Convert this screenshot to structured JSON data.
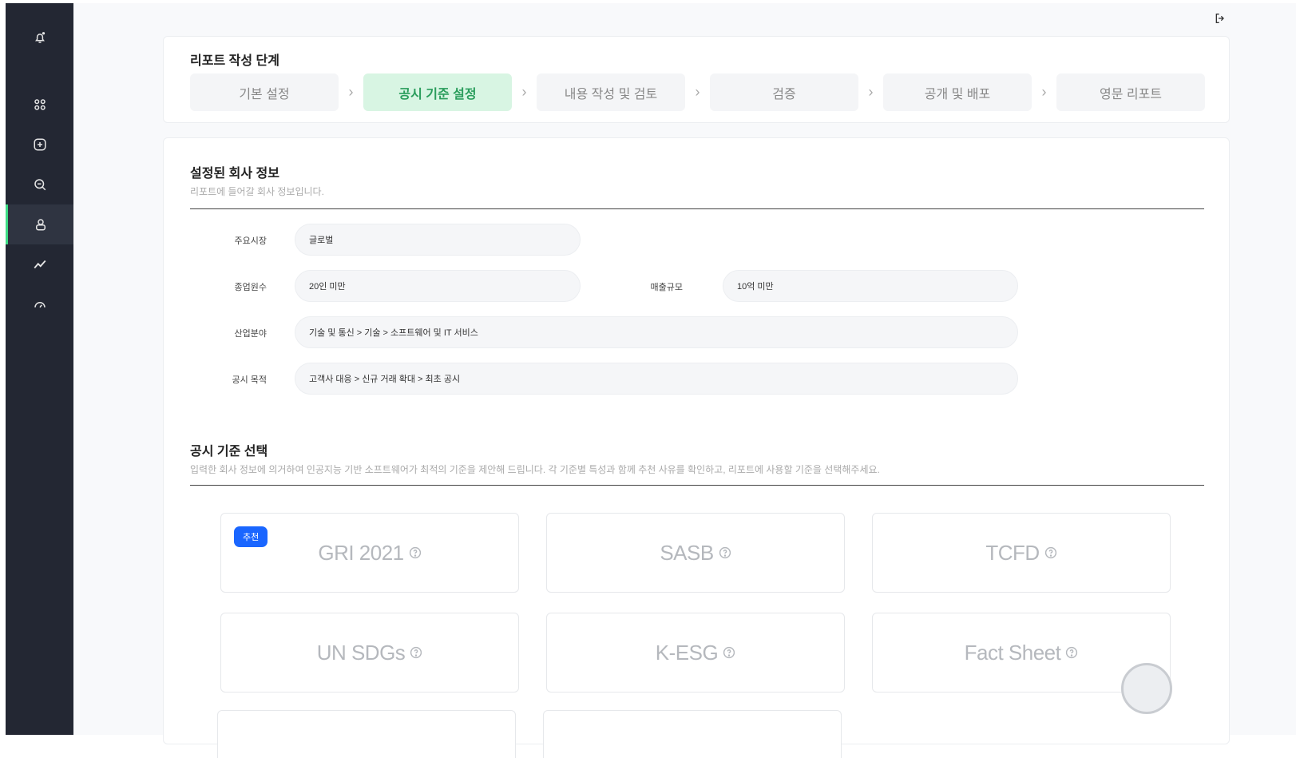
{
  "sidebar": {
    "icons": [
      "bell-icon",
      "grid-icon",
      "plus-square-icon",
      "search-icon",
      "user-report-icon",
      "trend-icon",
      "gauge-icon"
    ],
    "active": "user-report-icon",
    "accent": "#3ddc84"
  },
  "header": {
    "logout_icon": "logout-icon"
  },
  "steps": {
    "title": "리포트 작성 단계",
    "items": [
      {
        "label": "기본 설정"
      },
      {
        "label": "공시 기준 설정"
      },
      {
        "label": "내용 작성 및 검토"
      },
      {
        "label": "검증"
      },
      {
        "label": "공개 및 배포"
      },
      {
        "label": "영문 리포트"
      }
    ],
    "active_index": 1
  },
  "company": {
    "title": "설정된 회사 정보",
    "subtitle": "리포트에 들어갈 회사 정보입니다.",
    "fields": {
      "market_label": "주요시장",
      "market_value": "글로벌",
      "employees_label": "종업원수",
      "employees_value": "20인 미만",
      "revenue_label": "매출규모",
      "revenue_value": "10억 미만",
      "industry_label": "산업분야",
      "industry_value": "기술 및 통신 > 기술 > 소프트웨어 및 IT 서비스",
      "purpose_label": "공시 목적",
      "purpose_value": "고객사 대응 > 신규 거래 확대 > 최초 공시"
    }
  },
  "standards": {
    "title": "공시 기준 선택",
    "subtitle": "입력한 회사 정보에 의거하여 인공지능 기반 소프트웨어가 최적의 기준을 제안해 드립니다. 각 기준별 특성과 함께 추천 사유를 확인하고, 리포트에 사용할 기준을 선택해주세요.",
    "recommend_badge": "추천",
    "items": [
      {
        "label": "GRI 2021",
        "recommended": true
      },
      {
        "label": "SASB",
        "recommended": false
      },
      {
        "label": "TCFD",
        "recommended": false
      },
      {
        "label": "UN SDGs",
        "recommended": false
      },
      {
        "label": "K-ESG",
        "recommended": false
      },
      {
        "label": "Fact Sheet",
        "recommended": false
      }
    ]
  }
}
